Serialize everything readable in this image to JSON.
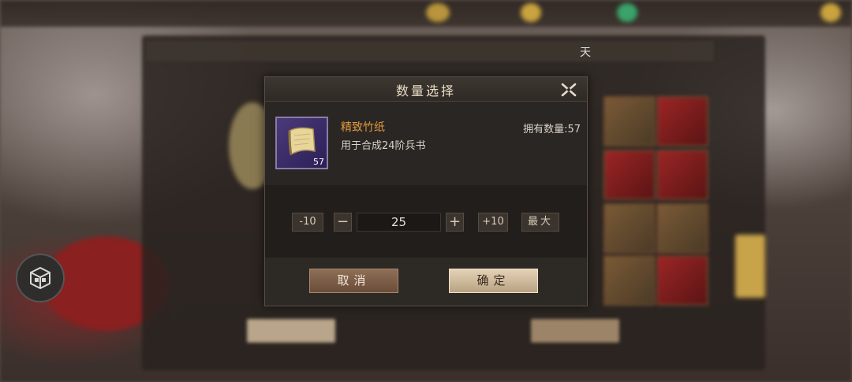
{
  "background": {
    "panel_title_fragment": "天"
  },
  "dialog": {
    "title": "数量选择",
    "item": {
      "name": "精致竹纸",
      "description": "用于合成24阶兵书",
      "count": "57",
      "icon": "scroll-paper-icon"
    },
    "owned_label": "拥有数量:57",
    "quantity": {
      "minus10_label": "-10",
      "minus_label": "−",
      "value": "25",
      "plus_label": "+",
      "plus10_label": "+10",
      "max_label": "最大"
    },
    "cancel_label": "取消",
    "confirm_label": "确定"
  },
  "colors": {
    "item_name": "#e09a3e",
    "item_slot": "#4b3a7a",
    "confirm_button": "#e4d2b6",
    "cancel_button": "#8e6e56"
  }
}
